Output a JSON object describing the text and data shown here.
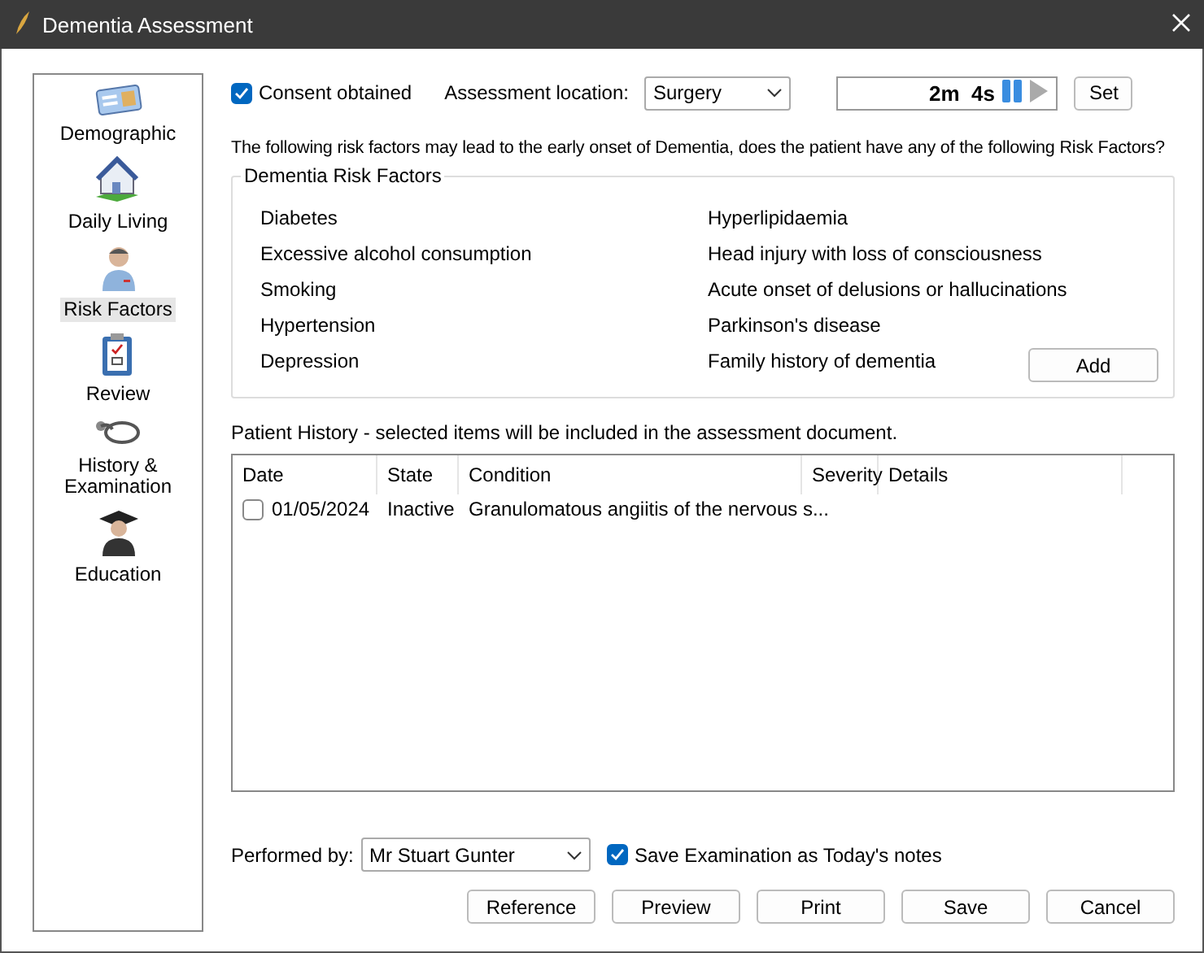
{
  "window": {
    "title": "Dementia Assessment"
  },
  "sidebar": {
    "items": [
      {
        "label": "Demographic",
        "kind": "card",
        "selected": false
      },
      {
        "label": "Daily Living",
        "kind": "house",
        "selected": false
      },
      {
        "label": "Risk Factors",
        "kind": "doctor",
        "selected": true
      },
      {
        "label": "Review",
        "kind": "clipboard",
        "selected": false
      },
      {
        "label": "History &\nExamination",
        "kind": "stethoscope",
        "selected": false
      },
      {
        "label": "Education",
        "kind": "graduate",
        "selected": false
      }
    ]
  },
  "consent": {
    "label": "Consent obtained",
    "checked": true
  },
  "location": {
    "label": "Assessment location:",
    "value": "Surgery"
  },
  "timer": {
    "reading": "2m  4s",
    "paused": true
  },
  "set_button": "Set",
  "question": "The following risk factors may lead to the early onset of Dementia, does the patient have any of the following Risk Factors?",
  "risk_factors": {
    "title": "Dementia Risk Factors",
    "left": [
      "Diabetes",
      "Excessive alcohol consumption",
      "Smoking",
      "Hypertension",
      "Depression"
    ],
    "right": [
      "Hyperlipidaemia",
      "Head injury with loss of consciousness",
      "Acute onset of delusions or hallucinations",
      "Parkinson's disease",
      "Family history of dementia"
    ],
    "add_button": "Add"
  },
  "history": {
    "label": "Patient History - selected items will be included in the assessment document.",
    "columns": [
      "Date",
      "State",
      "Condition",
      "Severity",
      "Details"
    ],
    "rows": [
      {
        "checked": false,
        "cells": [
          "01/05/2024",
          "Inactive",
          "Granulomatous angiitis of the nervous s...",
          "",
          ""
        ]
      }
    ]
  },
  "performed_by": {
    "label": "Performed by:",
    "value": "Mr Stuart Gunter"
  },
  "save_notes": {
    "label": "Save Examination as Today's notes",
    "checked": true
  },
  "buttons": [
    "Reference",
    "Preview",
    "Print",
    "Save",
    "Cancel"
  ]
}
